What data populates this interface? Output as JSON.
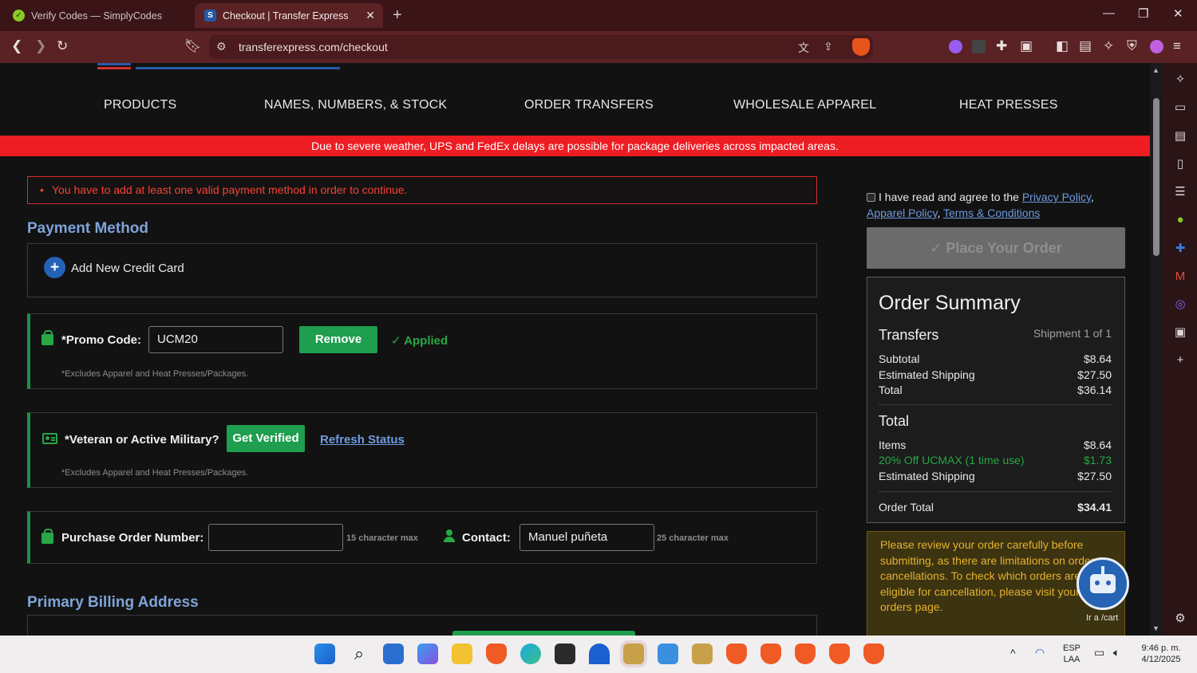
{
  "browser": {
    "tabs": [
      {
        "title": "Verify Codes — SimplyCodes",
        "active": false
      },
      {
        "title": "Checkout | Transfer Express",
        "active": true
      }
    ],
    "url": "transferexpress.com/checkout",
    "shield_count": "10",
    "ext_badge": "5"
  },
  "nav": {
    "items": [
      "PRODUCTS",
      "NAMES, NUMBERS, & STOCK",
      "ORDER TRANSFERS",
      "WHOLESALE APPAREL",
      "HEAT PRESSES"
    ]
  },
  "banner": "Due to severe weather, UPS and FedEx delays are possible for package deliveries across impacted areas.",
  "alert": "You have to add at least one valid payment method in order to continue.",
  "payment": {
    "title": "Payment Method",
    "add_card": "Add New Credit Card"
  },
  "promo": {
    "label": "*Promo Code:",
    "value": "UCM20",
    "button": "Remove",
    "status": "Applied",
    "note": "*Excludes Apparel and Heat Presses/Packages."
  },
  "military": {
    "label": "*Veteran or Active Military?",
    "button": "Get Verified",
    "link": "Refresh Status",
    "note": "*Excludes Apparel and Heat Presses/Packages."
  },
  "po": {
    "label": "Purchase Order Number:",
    "value": "",
    "max": "15 character max",
    "contact_label": "Contact:",
    "contact_value": "Manuel puñeta",
    "contact_max": "25 character max"
  },
  "billing": {
    "title": "Primary Billing Address"
  },
  "agreement": {
    "text": "I have read and agree to the",
    "privacy": "Privacy Policy",
    "apparel": "Apparel Policy",
    "terms": "Terms & Conditions"
  },
  "place_order": "Place Your Order",
  "summary": {
    "title": "Order Summary",
    "transfers": "Transfers",
    "shipment": "Shipment 1 of 1",
    "subtotal_label": "Subtotal",
    "subtotal": "$8.64",
    "est_ship_label": "Estimated Shipping",
    "est_ship": "$27.50",
    "total_label": "Total",
    "total": "$36.14",
    "total_heading": "Total",
    "items_label": "Items",
    "items": "$8.64",
    "discount_label": "20% Off UCMAX (1 time use)",
    "discount": "$1.73",
    "est_ship2_label": "Estimated Shipping",
    "est_ship2": "$27.50",
    "order_total_label": "Order Total",
    "order_total": "$34.41"
  },
  "warning": "Please review your order carefully before submitting, as there are limitations on order cancellations. To check which orders are eligible for cancellation, please visit your orders page.",
  "chatbot_label": "Ir a /cart",
  "system": {
    "lang1": "ESP",
    "lang2": "LAA",
    "time": "9:46 p. m.",
    "date": "4/12/2025"
  },
  "colors": {
    "banner": "#ee1c23",
    "accent_green": "#1e9e4e",
    "link_blue": "#6e9ae0",
    "title_blue": "#7fa3d8",
    "warning_text": "#e5b22e"
  }
}
